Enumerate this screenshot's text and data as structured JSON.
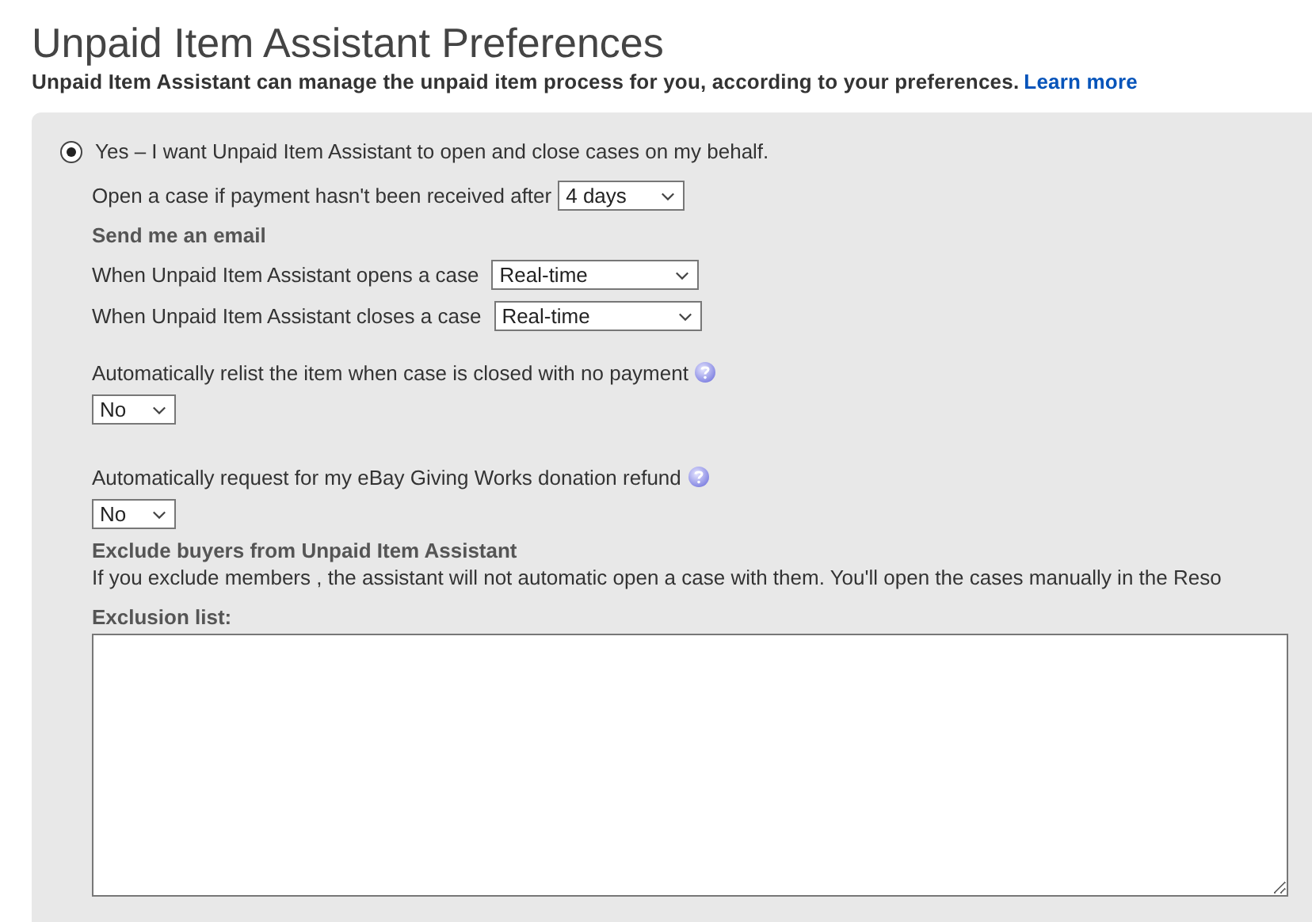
{
  "title": "Unpaid Item Assistant Preferences",
  "subtitle": {
    "text": "Unpaid Item Assistant can manage the unpaid item process for you, according to your preferences.",
    "link": "Learn more"
  },
  "option": {
    "label": "Yes – I want Unpaid Item Assistant to open and close cases on my behalf.",
    "selected": true
  },
  "open_case": {
    "label": "Open a case if payment hasn't been received after",
    "value": "4 days"
  },
  "email_heading": "Send me an email",
  "email_rows": [
    {
      "label": "When Unpaid Item Assistant opens a case",
      "value": "Real-time"
    },
    {
      "label": "When Unpaid Item Assistant closes a case",
      "value": "Real-time"
    }
  ],
  "auto_settings": [
    {
      "label": "Automatically relist the item when case is closed with no payment",
      "value": "No"
    },
    {
      "label": "Automatically request for my eBay Giving Works donation refund",
      "value": "No"
    }
  ],
  "exclude": {
    "heading": "Exclude buyers from Unpaid Item Assistant",
    "text": "If you exclude members , the assistant will not automatic open a case with them. You'll open the cases manually in the Reso"
  },
  "exclusion_list": {
    "label": "Exclusion list:"
  }
}
